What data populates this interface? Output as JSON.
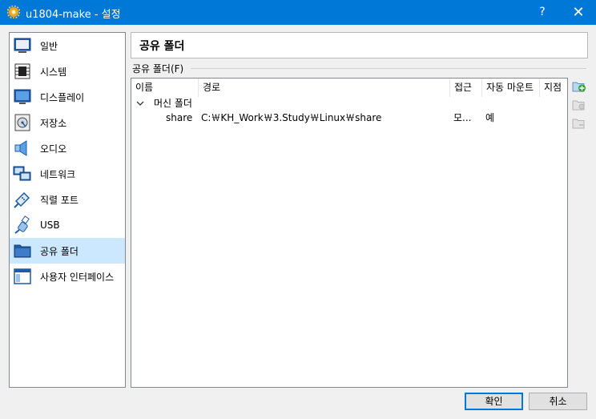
{
  "window": {
    "title": "u1804-make - 설정",
    "help": "?",
    "close": "✕"
  },
  "sidebar": {
    "items": [
      {
        "label": "일반",
        "icon": "general-icon"
      },
      {
        "label": "시스템",
        "icon": "system-icon"
      },
      {
        "label": "디스플레이",
        "icon": "display-icon"
      },
      {
        "label": "저장소",
        "icon": "storage-icon"
      },
      {
        "label": "오디오",
        "icon": "audio-icon"
      },
      {
        "label": "네트워크",
        "icon": "network-icon"
      },
      {
        "label": "직렬 포트",
        "icon": "serial-port-icon"
      },
      {
        "label": "USB",
        "icon": "usb-icon"
      },
      {
        "label": "공유 폴더",
        "icon": "shared-folder-icon",
        "selected": true
      },
      {
        "label": "사용자 인터페이스",
        "icon": "user-interface-icon"
      }
    ]
  },
  "page": {
    "title": "공유 폴더",
    "group_label": "공유 폴더(F)"
  },
  "table": {
    "columns": [
      "이름",
      "경로",
      "접근",
      "자동 마운트",
      "지점"
    ],
    "group": "머신 폴더",
    "rows": [
      {
        "name": "share",
        "path": "C:￦KH_Work￦3.Study￦Linux￦share",
        "access": "모...",
        "auto_mount": "예",
        "point": ""
      }
    ]
  },
  "buttons": {
    "ok": "확인",
    "cancel": "취소"
  },
  "colors": {
    "titlebar": "#0078d7",
    "selection": "#cce8ff",
    "accent": "#0078d7"
  }
}
